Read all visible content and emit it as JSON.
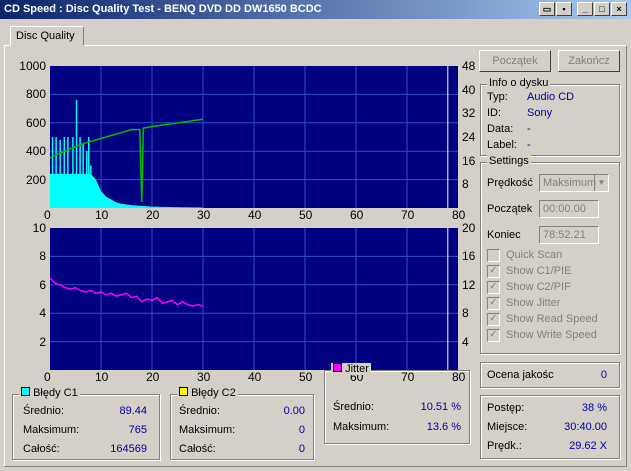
{
  "window": {
    "title": "CD Speed : Disc Quality Test - BENQ    DVD DD DW1650    BCDC"
  },
  "tabs": [
    {
      "label": "Disc Quality"
    }
  ],
  "buttons": {
    "start": "Początek",
    "stop": "Zakończ"
  },
  "disc_info": {
    "title": "Info o dysku",
    "rows": [
      {
        "label": "Typ:",
        "value": "Audio CD"
      },
      {
        "label": "ID:",
        "value": "Sony"
      },
      {
        "label": "Data:",
        "value": "-"
      },
      {
        "label": "Label:",
        "value": "-"
      }
    ]
  },
  "settings": {
    "title": "Settings",
    "speed_label": "Prędkość",
    "speed_value": "Maksimum",
    "start_label": "Początek",
    "start_value": "00:00.00",
    "end_label": "Koniec",
    "end_value": "78:52.21",
    "checkboxes": [
      {
        "label": "Quick Scan",
        "checked": false
      },
      {
        "label": "Show C1/PIE",
        "checked": true
      },
      {
        "label": "Show C2/PIF",
        "checked": true
      },
      {
        "label": "Show Jitter",
        "checked": true
      },
      {
        "label": "Show Read Speed",
        "checked": true
      },
      {
        "label": "Show Write Speed",
        "checked": true
      }
    ]
  },
  "quality": {
    "label": "Ocena jakośc",
    "value": "0"
  },
  "progress": {
    "rows": [
      {
        "label": "Postęp:",
        "value": "38 %"
      },
      {
        "label": "Miejsce:",
        "value": "30:40.00"
      },
      {
        "label": "Prędk.:",
        "value": "29.62 X"
      }
    ]
  },
  "stats": {
    "c1": {
      "title": "Błędy C1",
      "color": "#00ffff",
      "rows": [
        {
          "label": "Średnio:",
          "value": "89.44"
        },
        {
          "label": "Maksimum:",
          "value": "765"
        },
        {
          "label": "Całość:",
          "value": "164569"
        }
      ]
    },
    "c2": {
      "title": "Błędy C2",
      "color": "#ffff00",
      "rows": [
        {
          "label": "Średnio:",
          "value": "0.00"
        },
        {
          "label": "Maksimum:",
          "value": "0"
        },
        {
          "label": "Całość:",
          "value": "0"
        }
      ]
    },
    "jitter": {
      "title": "Jitter",
      "color": "#ff00ff",
      "rows": [
        {
          "label": "Średnio:",
          "value": "10.51 %"
        },
        {
          "label": "Maksimum:",
          "value": "13.6 %"
        }
      ]
    }
  },
  "chart_data": [
    {
      "type": "area",
      "title": "",
      "x_ticks": [
        "0",
        "10",
        "20",
        "30",
        "40",
        "50",
        "60",
        "70",
        "80"
      ],
      "y_ticks_left": [
        "200",
        "400",
        "600",
        "800",
        "1000"
      ],
      "y_ticks_right": [
        "8",
        "16",
        "24",
        "32",
        "40",
        "48"
      ],
      "xlim": [
        0,
        80
      ],
      "ylim": [
        0,
        1000
      ],
      "ylim_right": [
        0,
        48
      ],
      "series": [
        {
          "name": "C1",
          "color": "#00ffff",
          "x": [
            0,
            1,
            2,
            3,
            4,
            5,
            6,
            7,
            8,
            9,
            10,
            11,
            12,
            13,
            14,
            15,
            16,
            17,
            18,
            19,
            20,
            21,
            22,
            23,
            24,
            25,
            26,
            27,
            28,
            29,
            30
          ],
          "y": [
            240,
            240,
            240,
            240,
            240,
            240,
            240,
            240,
            240,
            200,
            120,
            80,
            60,
            40,
            30,
            25,
            20,
            18,
            15,
            12,
            10,
            10,
            8,
            8,
            6,
            6,
            5,
            5,
            4,
            4,
            3
          ]
        },
        {
          "name": "Read speed",
          "color": "#00c000",
          "axis": "right",
          "x": [
            0,
            2,
            4,
            6,
            8,
            10,
            12,
            14,
            16,
            17.6,
            18,
            18.3,
            20,
            22,
            24,
            26,
            28,
            30
          ],
          "y": [
            17,
            18.5,
            20,
            21.5,
            22.5,
            23.5,
            24.5,
            25.5,
            26.5,
            26.5,
            2,
            27,
            27.5,
            28,
            28.5,
            29,
            29.5,
            30
          ]
        },
        {
          "name": "Max speed",
          "color": "#ffffff",
          "axis": "right",
          "x": [
            78
          ],
          "y": [
            48
          ]
        }
      ],
      "spikes_x": [
        0.5,
        1.2,
        2.0,
        2.8,
        3.5,
        4.5,
        5.2,
        5.9,
        6.5,
        7.2,
        7.6,
        8.0
      ],
      "spikes_y": [
        500,
        500,
        480,
        500,
        500,
        500,
        760,
        500,
        450,
        400,
        500,
        300
      ]
    },
    {
      "type": "line",
      "title": "",
      "x_ticks": [
        "0",
        "10",
        "20",
        "30",
        "40",
        "50",
        "60",
        "70",
        "80"
      ],
      "y_ticks_left": [
        "2",
        "4",
        "6",
        "8",
        "10"
      ],
      "y_ticks_right": [
        "4",
        "8",
        "12",
        "16",
        "20"
      ],
      "xlim": [
        0,
        80
      ],
      "ylim": [
        0,
        10
      ],
      "series": [
        {
          "name": "Jitter",
          "color": "#ff00ff",
          "x": [
            0,
            1,
            2,
            3,
            4,
            5,
            6,
            7,
            8,
            9,
            10,
            11,
            12,
            13,
            14,
            15,
            16,
            17,
            18,
            19,
            20,
            21,
            22,
            23,
            24,
            25,
            26,
            27,
            28,
            29,
            30
          ],
          "y": [
            6.5,
            6.1,
            6.0,
            5.8,
            5.7,
            5.8,
            5.6,
            5.5,
            5.6,
            5.4,
            5.5,
            5.3,
            5.4,
            5.2,
            5.3,
            5.4,
            5.1,
            5.2,
            4.8,
            5.0,
            4.9,
            5.1,
            4.7,
            4.8,
            4.9,
            4.6,
            4.8,
            4.6,
            4.5,
            4.6,
            4.5
          ]
        }
      ]
    }
  ]
}
